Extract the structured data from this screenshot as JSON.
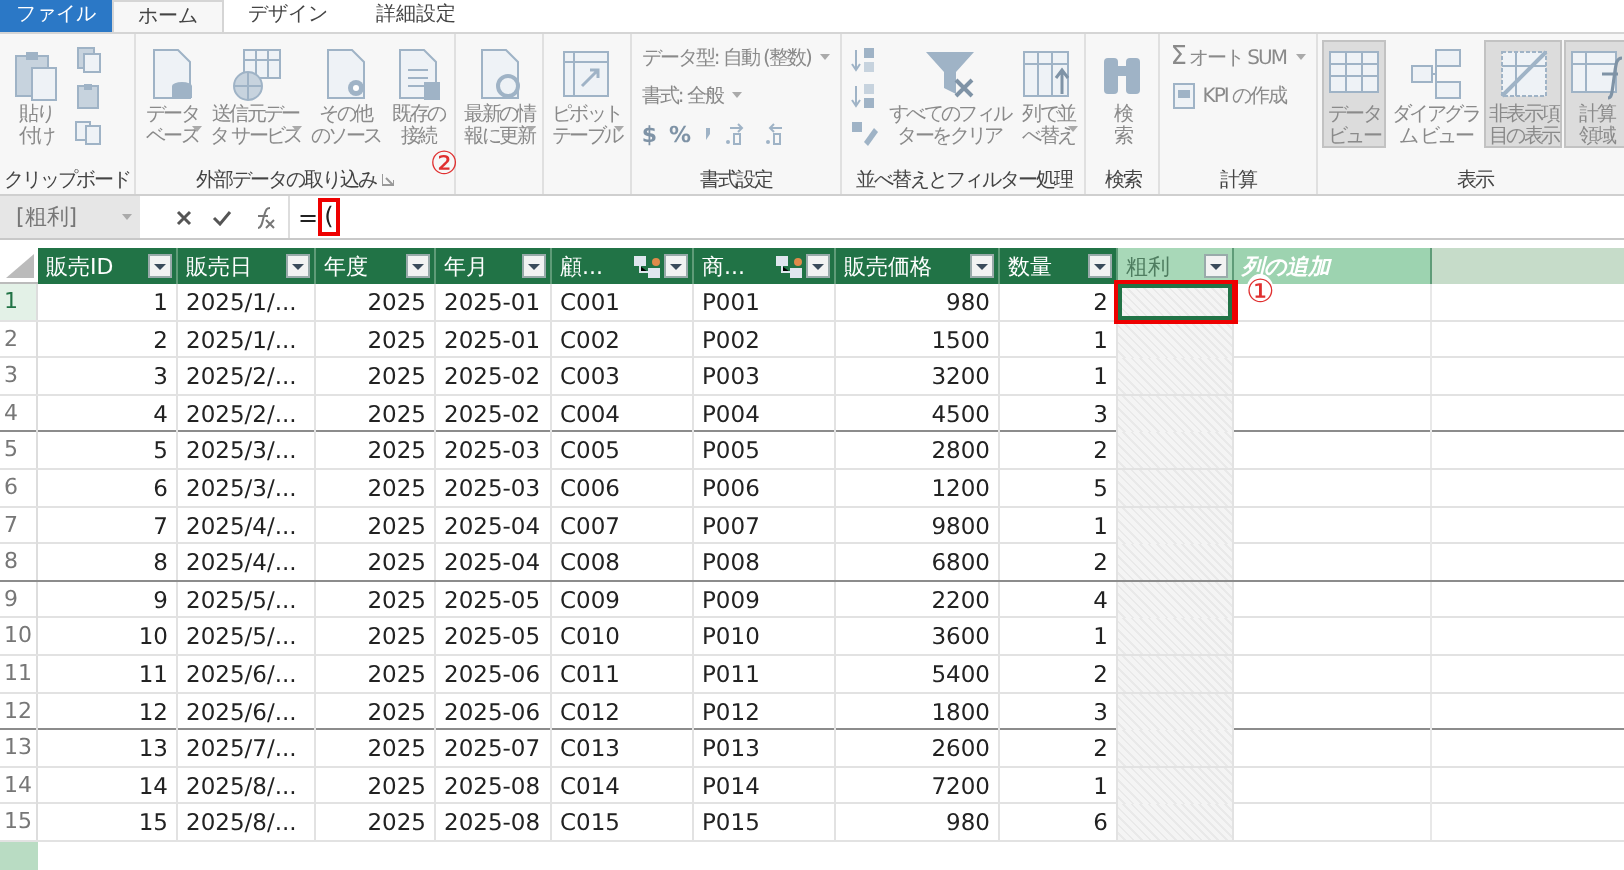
{
  "ribbon": {
    "tabs": [
      {
        "label": "ファイル",
        "kind": "file",
        "selected": false
      },
      {
        "label": "ホーム",
        "kind": "tab",
        "selected": true
      },
      {
        "label": "デザイン",
        "kind": "tab",
        "selected": false
      },
      {
        "label": "詳細設定",
        "kind": "tab",
        "selected": false
      }
    ],
    "groups": [
      {
        "label": "クリップボード",
        "items": [
          {
            "kind": "large",
            "label": [
              "貼り",
              "付け"
            ],
            "dropdown": false,
            "selected": false
          },
          {
            "kind": "icon-stack"
          }
        ]
      },
      {
        "label": "外部データの取り込み",
        "launcher": true,
        "items": [
          {
            "kind": "large",
            "label": [
              "データ",
              "ベース"
            ],
            "dropdown": true,
            "selected": false
          },
          {
            "kind": "large",
            "label": [
              "送信元デー",
              "タ サービス"
            ],
            "dropdown": true,
            "selected": false
          },
          {
            "kind": "large",
            "label": [
              "その他",
              "のソース"
            ],
            "dropdown": false,
            "selected": false
          },
          {
            "kind": "large",
            "label": [
              "既存の",
              "接続"
            ],
            "dropdown": false,
            "selected": false
          }
        ]
      },
      {
        "items": [
          {
            "kind": "large",
            "label": [
              "最新の情",
              "報に更新"
            ],
            "dropdown": true,
            "selected": false
          }
        ]
      },
      {
        "items": [
          {
            "kind": "large",
            "label": [
              "ピボット",
              "テーブル"
            ],
            "dropdown": true,
            "selected": false
          }
        ]
      },
      {
        "label": "書式設定",
        "items": [
          {
            "kind": "format",
            "rows": [
              {
                "label": "データ型: 自動 (整数)",
                "dropdown": true
              },
              {
                "label": "書式: 全般",
                "dropdown": true
              }
            ],
            "symbols": [
              "$",
              "%"
            ]
          }
        ]
      },
      {
        "label": "並べ替えとフィルター処理",
        "items": [
          {
            "kind": "sort-stack"
          },
          {
            "kind": "large",
            "label": [
              "すべてのフィル",
              "ターをクリア"
            ],
            "dropdown": false,
            "selected": false
          },
          {
            "kind": "large",
            "label": [
              "列で並",
              "べ替え"
            ],
            "dropdown": true,
            "selected": false
          }
        ]
      },
      {
        "label": "検索",
        "items": [
          {
            "kind": "large",
            "label": [
              "検",
              "索"
            ],
            "dropdown": false,
            "selected": false
          }
        ]
      },
      {
        "label": "計算",
        "items": [
          {
            "kind": "calc",
            "rows": [
              {
                "symbol": "Σ",
                "label": "オート SUM",
                "dropdown": true
              },
              {
                "label": "KPI の作成",
                "dropdown": false
              }
            ]
          }
        ]
      },
      {
        "label": "表示",
        "items": [
          {
            "kind": "large",
            "label": [
              "データ",
              "ビュー"
            ],
            "dropdown": false,
            "selected": true
          },
          {
            "kind": "large",
            "label": [
              "ダイアグラ",
              "ム ビュー"
            ],
            "dropdown": false,
            "selected": false
          },
          {
            "kind": "large",
            "label": [
              "非表示項",
              "目の表示"
            ],
            "dropdown": false,
            "selected": true
          },
          {
            "kind": "large",
            "label": [
              "計算",
              "領域"
            ],
            "dropdown": false,
            "selected": true
          }
        ]
      }
    ]
  },
  "formula_bar": {
    "name_box": "[粗利]",
    "formula": [
      {
        "text": "=",
        "highlighted": false
      },
      {
        "text": "(",
        "highlighted": true
      }
    ]
  },
  "table": {
    "columns": [
      {
        "label": "販売ID",
        "kind": "number",
        "related": false
      },
      {
        "label": "販売日",
        "kind": "text",
        "related": false
      },
      {
        "label": "年度",
        "kind": "number",
        "related": false
      },
      {
        "label": "年月",
        "kind": "text",
        "related": false
      },
      {
        "label": "顧...",
        "kind": "text",
        "related": true
      },
      {
        "label": "商...",
        "kind": "text",
        "related": true
      },
      {
        "label": "販売価格",
        "kind": "number",
        "related": false
      },
      {
        "label": "数量",
        "kind": "number",
        "related": false
      },
      {
        "label": "粗利",
        "kind": "calc",
        "related": false
      },
      {
        "label": "列の追加",
        "kind": "add"
      }
    ],
    "rows": [
      {
        "number": "1",
        "selected": true,
        "highlighted": true,
        "cells": [
          "1",
          "2025/1/...",
          "2025",
          "2025-01",
          "C001",
          "P001",
          "980",
          "2"
        ]
      },
      {
        "number": "2",
        "selected": false,
        "highlighted": false,
        "cells": [
          "2",
          "2025/1/...",
          "2025",
          "2025-01",
          "C002",
          "P002",
          "1500",
          "1"
        ]
      },
      {
        "number": "3",
        "selected": false,
        "highlighted": false,
        "cells": [
          "3",
          "2025/2/...",
          "2025",
          "2025-02",
          "C003",
          "P003",
          "3200",
          "1"
        ]
      },
      {
        "number": "4",
        "selected": false,
        "highlighted": false,
        "cells": [
          "4",
          "2025/2/...",
          "2025",
          "2025-02",
          "C004",
          "P004",
          "4500",
          "3"
        ]
      },
      {
        "number": "5",
        "selected": false,
        "highlighted": false,
        "cells": [
          "5",
          "2025/3/...",
          "2025",
          "2025-03",
          "C005",
          "P005",
          "2800",
          "2"
        ]
      },
      {
        "number": "6",
        "selected": false,
        "highlighted": false,
        "cells": [
          "6",
          "2025/3/...",
          "2025",
          "2025-03",
          "C006",
          "P006",
          "1200",
          "5"
        ]
      },
      {
        "number": "7",
        "selected": false,
        "highlighted": false,
        "cells": [
          "7",
          "2025/4/...",
          "2025",
          "2025-04",
          "C007",
          "P007",
          "9800",
          "1"
        ]
      },
      {
        "number": "8",
        "selected": false,
        "highlighted": false,
        "cells": [
          "8",
          "2025/4/...",
          "2025",
          "2025-04",
          "C008",
          "P008",
          "6800",
          "2"
        ]
      },
      {
        "number": "9",
        "selected": false,
        "highlighted": false,
        "cells": [
          "9",
          "2025/5/...",
          "2025",
          "2025-05",
          "C009",
          "P009",
          "2200",
          "4"
        ]
      },
      {
        "number": "10",
        "selected": false,
        "highlighted": false,
        "cells": [
          "10",
          "2025/5/...",
          "2025",
          "2025-05",
          "C010",
          "P010",
          "3600",
          "1"
        ]
      },
      {
        "number": "11",
        "selected": false,
        "highlighted": false,
        "cells": [
          "11",
          "2025/6/...",
          "2025",
          "2025-06",
          "C011",
          "P011",
          "5400",
          "2"
        ]
      },
      {
        "number": "12",
        "selected": false,
        "highlighted": false,
        "cells": [
          "12",
          "2025/6/...",
          "2025",
          "2025-06",
          "C012",
          "P012",
          "1800",
          "3"
        ]
      },
      {
        "number": "13",
        "selected": false,
        "highlighted": false,
        "cells": [
          "13",
          "2025/7/...",
          "2025",
          "2025-07",
          "C013",
          "P013",
          "2600",
          "2"
        ]
      },
      {
        "number": "14",
        "selected": false,
        "highlighted": false,
        "cells": [
          "14",
          "2025/8/...",
          "2025",
          "2025-08",
          "C014",
          "P014",
          "7200",
          "1"
        ]
      },
      {
        "number": "15",
        "selected": false,
        "highlighted": false,
        "cells": [
          "15",
          "2025/8/...",
          "2025",
          "2025-08",
          "C015",
          "P015",
          "980",
          "6"
        ]
      }
    ]
  },
  "annotations": [
    {
      "text": "②",
      "kind": "formula"
    },
    {
      "text": "①",
      "kind": "cell"
    }
  ]
}
